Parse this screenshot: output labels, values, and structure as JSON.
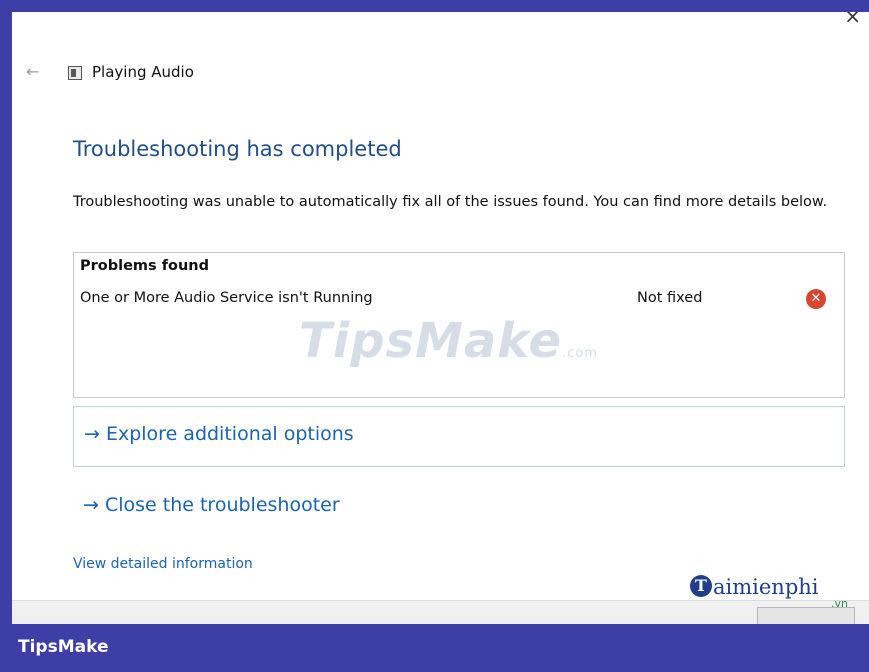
{
  "window": {
    "app_title": "Playing Audio",
    "close_glyph": "×",
    "back_glyph": "←"
  },
  "status": {
    "heading": "Troubleshooting has completed",
    "description": "Troubleshooting was unable to automatically fix all of the issues found. You can find more details below."
  },
  "problems": {
    "header": "Problems found",
    "items": [
      {
        "name": "One or More Audio Service isn't Running",
        "status": "Not fixed",
        "status_icon": "error-icon"
      }
    ]
  },
  "links": {
    "explore": "→ Explore additional options",
    "close": "→ Close the troubleshooter",
    "details": "View detailed information"
  },
  "watermarks": {
    "tipsmake": "TipsMake",
    "tipsmake_suffix": ".com",
    "brand_name": "aimienphi",
    "brand_tld": ".vn",
    "bottom_label": "TipsMake"
  },
  "colors": {
    "border_blue": "#3e3fa6",
    "heading_blue": "#1f4e8a",
    "link_blue": "#1a63b5",
    "error_red": "#d9462f"
  }
}
